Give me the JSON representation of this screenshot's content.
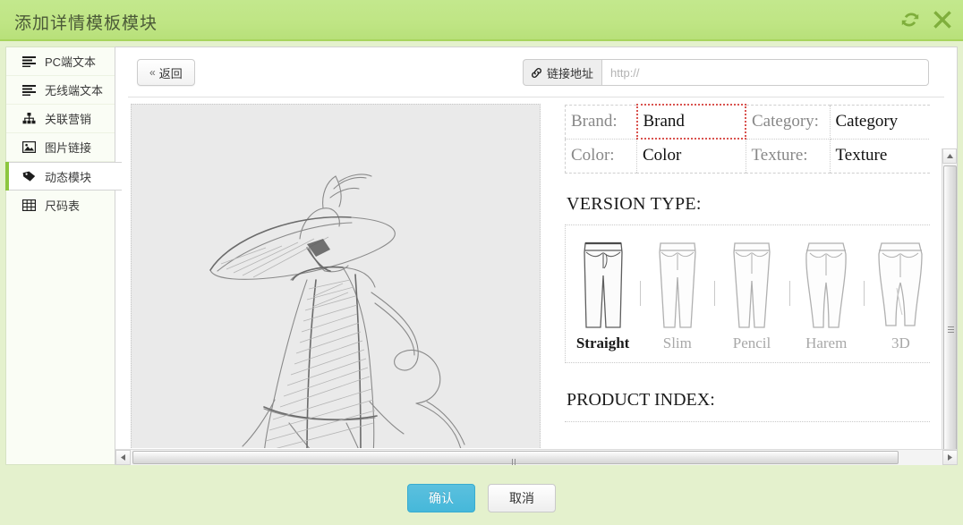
{
  "window": {
    "title": "添加详情模板模块",
    "refresh_icon": "refresh-icon",
    "close_icon": "close-icon"
  },
  "sidebar": {
    "items": [
      {
        "label": "PC端文本",
        "icon": "align-left-icon",
        "active": false
      },
      {
        "label": "无线端文本",
        "icon": "align-left-icon",
        "active": false
      },
      {
        "label": "关联营销",
        "icon": "sitemap-icon",
        "active": false
      },
      {
        "label": "图片链接",
        "icon": "image-icon",
        "active": false
      },
      {
        "label": "动态模块",
        "icon": "tag-icon",
        "active": true
      },
      {
        "label": "尺码表",
        "icon": "table-icon",
        "active": false
      }
    ]
  },
  "toolbar": {
    "back_label": "返回",
    "back_chevron": "«",
    "link_label": "链接地址",
    "link_icon": "link-icon",
    "link_value": "",
    "link_placeholder": "http://"
  },
  "editor": {
    "attributes": [
      {
        "key": "Brand:",
        "value": "Brand",
        "selected": true,
        "key2": "Category:",
        "value2": "Category"
      },
      {
        "key": "Color:",
        "value": "Color",
        "selected": false,
        "key2": "Texture:",
        "value2": "Texture"
      }
    ],
    "version_type": {
      "title": "VERSION TYPE:",
      "options": [
        {
          "name": "Straight",
          "selected": true
        },
        {
          "name": "Slim",
          "selected": false
        },
        {
          "name": "Pencil",
          "selected": false
        },
        {
          "name": "Harem",
          "selected": false
        },
        {
          "name": "3D",
          "selected": false
        }
      ]
    },
    "product_index_title": "PRODUCT INDEX:",
    "sketch_alt": "fashion-sketch-woman-hat-cape"
  },
  "footer": {
    "confirm_label": "确认",
    "cancel_label": "取消"
  },
  "colors": {
    "header_green": "#bfe584",
    "header_border": "#a7d45c",
    "accent_green": "#8cc63f",
    "primary_blue": "#46b8da",
    "footer_bg": "#e4f1cd",
    "selected_cell_red": "#d9534f"
  }
}
